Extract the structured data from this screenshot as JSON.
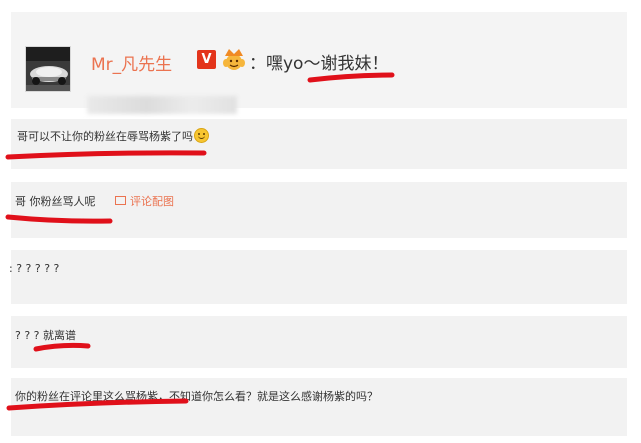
{
  "header": {
    "username": "Mr_凡先生",
    "verified_badge": "V",
    "crown_icon": "crown-emoji-icon",
    "text": "：嘿yo～谢我妹！"
  },
  "comments": [
    {
      "text": "哥可以不让你的粉丝在辱骂杨紫了吗",
      "emoji": "smile-emoji-icon"
    },
    {
      "text": "哥 你粉丝骂人呢",
      "link_icon": "picture-icon",
      "link": "评论配图"
    },
    {
      "text": ": ? ? ? ? ?"
    },
    {
      "text": "? ? ? 就离谱"
    },
    {
      "text": "你的粉丝在评论里这么骂杨紫，不知道你怎么看？就是这么感谢杨紫的吗？"
    }
  ],
  "colors": {
    "username": "#eb7350",
    "badge": "#e3341b",
    "annotation": "#e0101a",
    "card_bg": "#f2f2f2",
    "text": "#333333"
  }
}
